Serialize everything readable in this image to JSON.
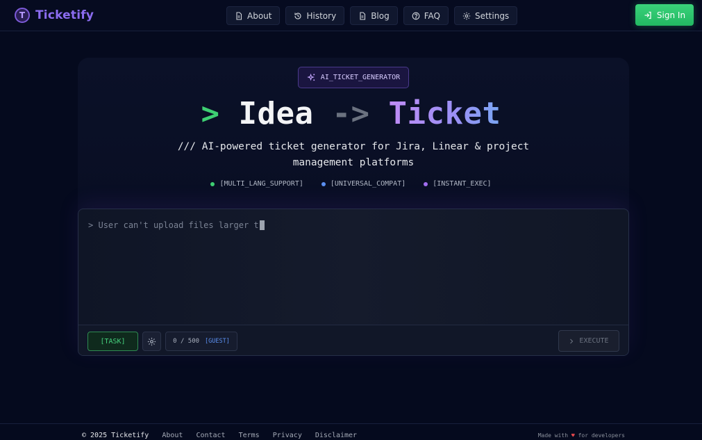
{
  "header": {
    "logo_letter": "T",
    "logo_text": "Ticketify",
    "nav": [
      {
        "label": "About",
        "icon": "document-icon"
      },
      {
        "label": "History",
        "icon": "history-icon"
      },
      {
        "label": "Blog",
        "icon": "document-icon"
      },
      {
        "label": "FAQ",
        "icon": "help-circle-icon"
      },
      {
        "label": "Settings",
        "icon": "gear-icon"
      }
    ],
    "signin_label": "Sign In"
  },
  "hero": {
    "badge": "AI_TICKET_GENERATOR",
    "headline": {
      "prompt": ">",
      "idea": "Idea",
      "arrow": "->",
      "ticket": "Ticket"
    },
    "subtitle_line1": "/// AI-powered ticket generator for Jira, Linear & project",
    "subtitle_line2": "management platforms",
    "features": [
      {
        "label": "[MULTI_LANG_SUPPORT]",
        "color": "#3ecf72"
      },
      {
        "label": "[UNIVERSAL_COMPAT]",
        "color": "#5b8ff0"
      },
      {
        "label": "[INSTANT_EXEC]",
        "color": "#a16ef0"
      }
    ]
  },
  "input": {
    "prompt": ">",
    "value": "User can't upload files larger t",
    "task_label": "[TASK]",
    "counter": "0 / 500",
    "guest_label": "[GUEST]",
    "execute_label": "EXECUTE"
  },
  "footer": {
    "copyright": "© 2025 Ticketify",
    "links": [
      "About",
      "Contact",
      "Terms",
      "Privacy",
      "Disclaimer"
    ],
    "made_with_pre": "Made with",
    "made_with_post": "for developers"
  },
  "colors": {
    "background": "#050a1e",
    "brand_purple": "#8b6cf0",
    "accent_green": "#3ecf72",
    "accent_blue": "#5b8ff0"
  }
}
